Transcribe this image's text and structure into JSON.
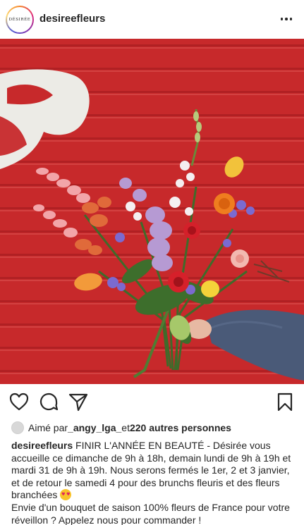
{
  "header": {
    "avatar_text": "DÉSIRÉE",
    "username": "desireefleurs"
  },
  "post": {
    "image_description_icon": "bouquet-photo"
  },
  "actions": {
    "like_icon": "heart-icon",
    "comment_icon": "comment-icon",
    "share_icon": "paper-plane-icon",
    "save_icon": "bookmark-icon"
  },
  "likes": {
    "prefix": "Aimé par ",
    "user": "_angy_lga_",
    "middle": " et ",
    "others": "220 autres personnes"
  },
  "caption": {
    "username": "desireefleurs",
    "line1": " FINIR L'ANNÉE EN BEAUTÉ - Désirée vous accueille ce dimanche de 9h à 18h, demain lundi de 9h à 19h et mardi 31 de 9h à 19h. Nous serons fermés le 1er, 2 et 3 janvier, et de retour le samedi 4 pour des brunchs fleuris et des fleurs branchées ",
    "line2": "Envie d'un bouquet de saison 100% fleurs de France pour votre réveillon ? Appelez nous pour commander !"
  },
  "colors": {
    "shutter_red": "#c9282a",
    "text": "#262626"
  }
}
